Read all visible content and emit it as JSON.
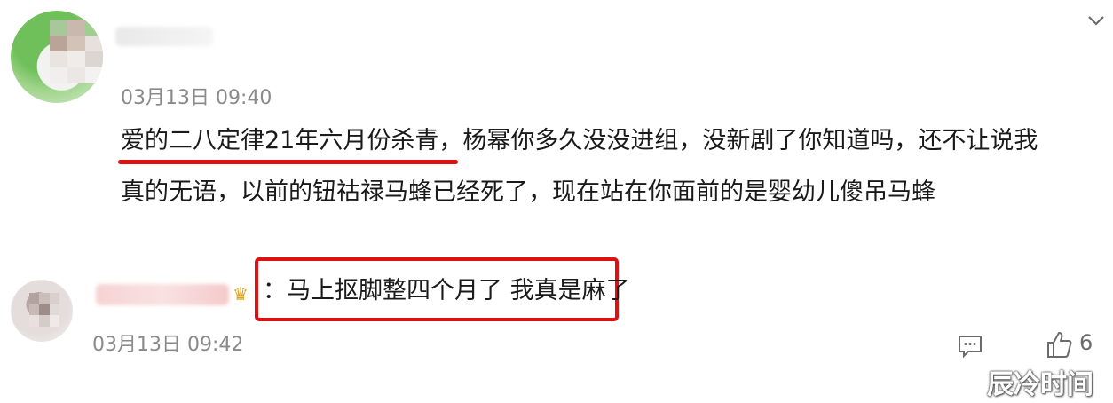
{
  "comment": {
    "timestamp": "03月13日 09:40",
    "line1_underlined": "爱的二八定律21年六月份杀青",
    "line1_rest": "，杨幂你多久没没进组，没新剧了你知道吗，还不让说我",
    "line2": "真的无语，以前的钮祜禄马蜂已经死了，现在站在你面前的是婴幼儿傻吊马蜂",
    "underline_color": "#e01010"
  },
  "reply": {
    "text": "：马上抠脚整四个月了 我真是麻了",
    "timestamp": "03月13日 09:42",
    "highlight_color": "#e01010",
    "like_count": "6"
  },
  "icons": {
    "menu": "chevron-down-icon",
    "comment": "comment-icon",
    "like": "thumbs-up-icon",
    "badge": "crown-icon"
  },
  "watermark": "辰冷时间"
}
